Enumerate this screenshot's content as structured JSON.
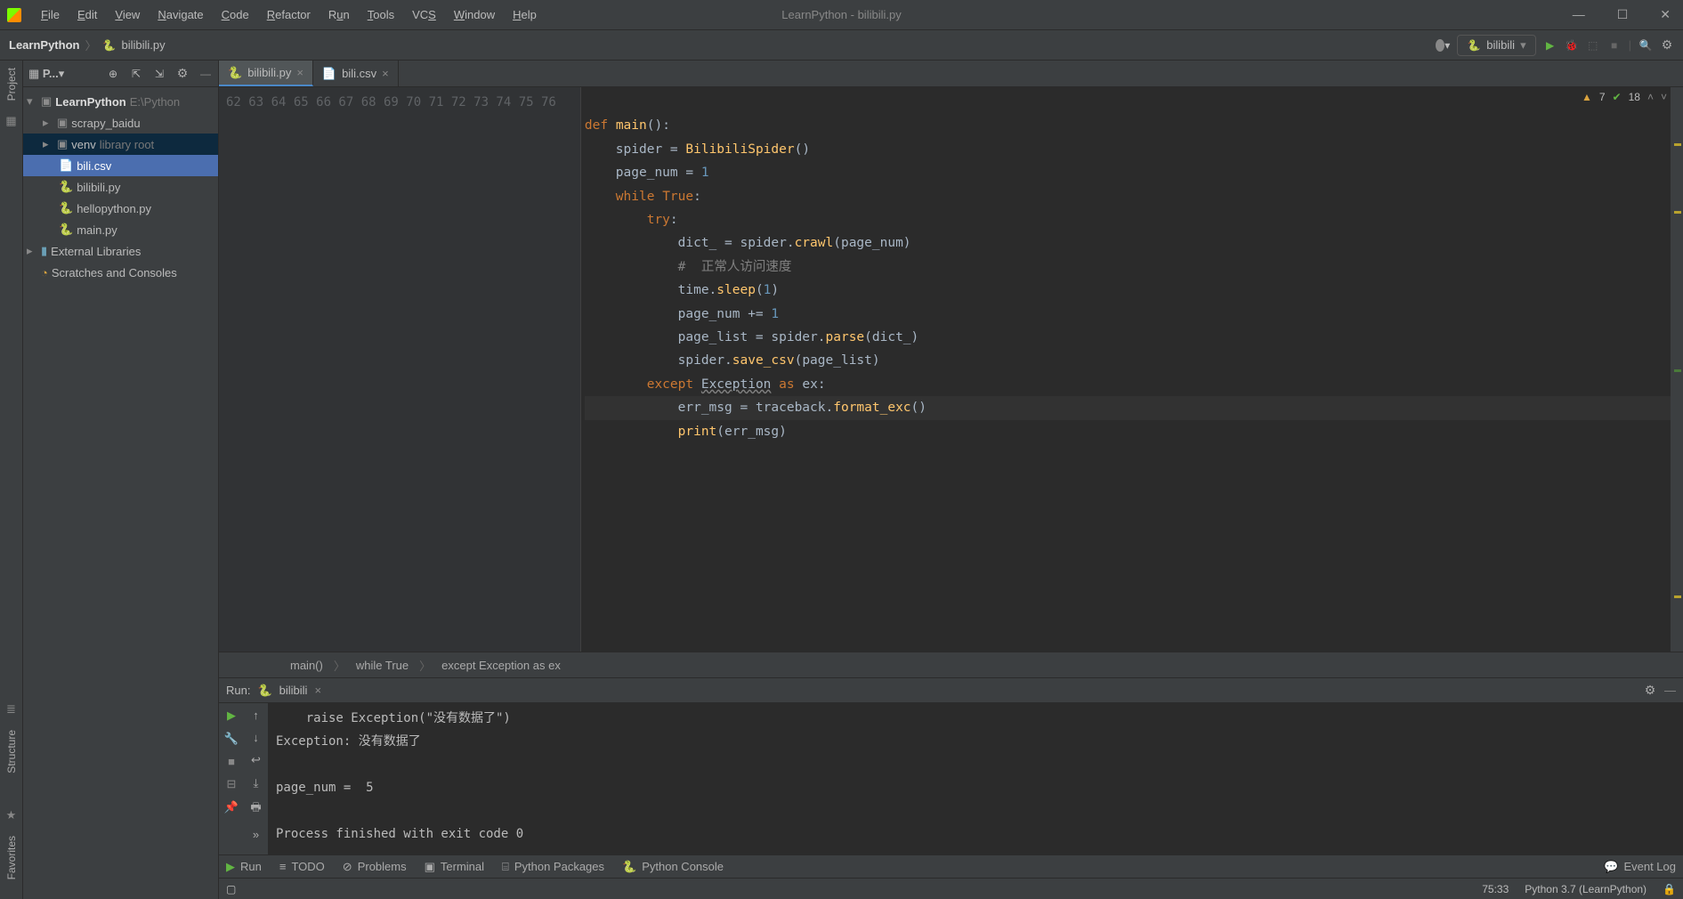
{
  "title": "LearnPython - bilibili.py",
  "menu": [
    "File",
    "Edit",
    "View",
    "Navigate",
    "Code",
    "Refactor",
    "Run",
    "Tools",
    "VCS",
    "Window",
    "Help"
  ],
  "breadcrumb": {
    "project": "LearnPython",
    "file": "bilibili.py"
  },
  "runconfig": {
    "name": "bilibili"
  },
  "editor_status": {
    "warnings": "7",
    "ok": "18"
  },
  "project_tree": {
    "root": {
      "name": "LearnPython",
      "location": "E:\\Python"
    },
    "children": [
      {
        "name": "scrapy_baidu",
        "kind": "folder"
      },
      {
        "name": "venv",
        "kind": "folder",
        "suffix": "library root"
      },
      {
        "name": "bili.csv",
        "kind": "csv"
      },
      {
        "name": "bilibili.py",
        "kind": "py"
      },
      {
        "name": "hellopython.py",
        "kind": "py"
      },
      {
        "name": "main.py",
        "kind": "py"
      }
    ],
    "extra": [
      {
        "name": "External Libraries"
      },
      {
        "name": "Scratches and Consoles"
      }
    ]
  },
  "tabs": [
    {
      "name": "bilibili.py",
      "icon": "py",
      "active": true
    },
    {
      "name": "bili.csv",
      "icon": "csv",
      "active": false
    }
  ],
  "line_start": 62,
  "line_end": 76,
  "code_lines": [
    "",
    "def main():",
    "    spider = BilibiliSpider()",
    "    page_num = 1",
    "    while True:",
    "        try:",
    "            dict_ = spider.crawl(page_num)",
    "            #  正常人访问速度",
    "            time.sleep(1)",
    "            page_num += 1",
    "            page_list = spider.parse(dict_)",
    "            spider.save_csv(page_list)",
    "        except Exception as ex:",
    "            err_msg = traceback.format_exc()",
    "            print(err_msg)"
  ],
  "scope": [
    "main()",
    "while True",
    "except Exception as ex"
  ],
  "run_tab": {
    "label": "Run:",
    "name": "bilibili"
  },
  "console_lines": [
    "    raise Exception(\"没有数据了\")",
    "Exception: 没有数据了",
    "",
    "page_num =  5",
    "",
    "Process finished with exit code 0"
  ],
  "tool_windows": [
    "Run",
    "TODO",
    "Problems",
    "Terminal",
    "Python Packages",
    "Python Console"
  ],
  "event_log": "Event Log",
  "status": {
    "cursor": "75:33",
    "interpreter": "Python 3.7 (LearnPython)"
  },
  "side_labels": {
    "project": "Project",
    "structure": "Structure",
    "favorites": "Favorites"
  },
  "project_pane_label": "P..."
}
